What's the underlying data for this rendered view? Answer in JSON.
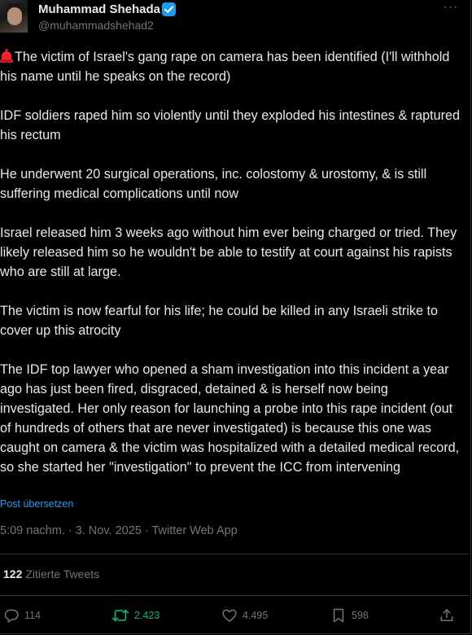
{
  "author": {
    "display_name": "Muhammad Shehada",
    "handle": "@muhammadshehad2",
    "verified_icon": "verified-badge-icon",
    "avatar_icon": "avatar"
  },
  "more_icon": "more-options-icon",
  "tweet": {
    "emoji": "police-car-light-icon",
    "paragraphs": [
      "The victim of Israel's gang rape on camera has been identified (I'll withhold his name until he speaks on the record)",
      "IDF soldiers raped him so violently until they exploded his intestines & raptured his rectum",
      "He underwent 20 surgical operations, inc. colostomy & urostomy, & is still suffering medical complications until now",
      "Israel released him 3 weeks ago without him ever being charged or tried. They likely released him so he wouldn't be able to testify at court against his rapists who are still at large.",
      "The victim is now fearful for his life; he could be killed in any Israeli strike to cover up this atrocity",
      "The IDF top lawyer who opened a sham investigation into this incident a year ago has just been fired, disgraced, detained & is herself now being investigated. Her only reason for launching a probe into this rape incident (out of hundreds of others that are never investigated) is because this one was caught on camera & the victim was hospitalized with a detailed medical record, so she started her \"investigation\" to prevent the ICC from intervening"
    ],
    "translate_label": "Post übersetzen",
    "meta": "5:09 nachm. · 3. Nov. 2025 · Twitter Web App"
  },
  "quotes": {
    "count": "122",
    "label": "Zitierte Tweets"
  },
  "actions": {
    "reply": {
      "icon": "reply-icon",
      "count": "114"
    },
    "retweet": {
      "icon": "retweet-icon",
      "count": "2.423",
      "color": "#00ba7c"
    },
    "like": {
      "icon": "heart-icon",
      "count": "4.495"
    },
    "bookmark": {
      "icon": "bookmark-icon",
      "count": "598"
    },
    "share": {
      "icon": "share-icon"
    }
  },
  "colors": {
    "background": "#000000",
    "text": "#e7e9ea",
    "secondary": "#71767b",
    "accent": "#1d9bf0",
    "divider": "#2f3336"
  }
}
